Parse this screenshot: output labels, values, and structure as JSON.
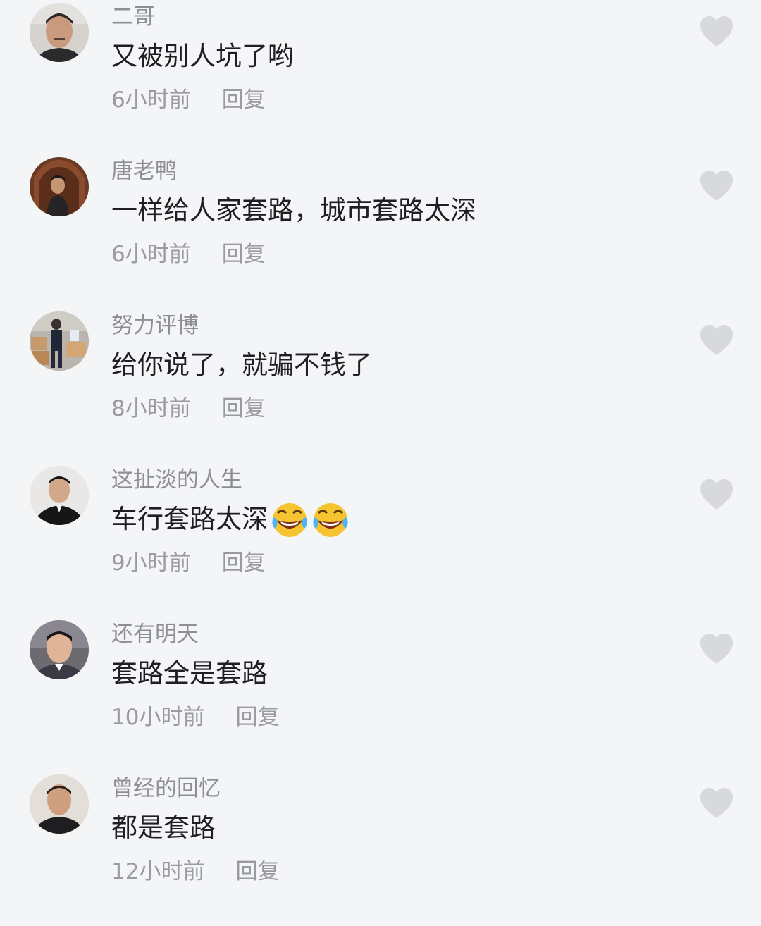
{
  "comments": [
    {
      "username": "二哥",
      "text": "又被别人坑了哟",
      "emoji_count": 0,
      "time": "6小时前",
      "reply_label": "回复",
      "avatar_icon": "avatar-man-1"
    },
    {
      "username": "唐老鸭",
      "text": "一样给人家套路，城市套路太深",
      "emoji_count": 0,
      "time": "6小时前",
      "reply_label": "回复",
      "avatar_icon": "avatar-man-carving"
    },
    {
      "username": "努力评博",
      "text": "给你说了，就骗不钱了",
      "emoji_count": 0,
      "time": "8小时前",
      "reply_label": "回复",
      "avatar_icon": "avatar-warehouse"
    },
    {
      "username": "这扯淡的人生",
      "text": "车行套路太深",
      "emoji_count": 2,
      "emoji_icon": "rofl-emoji",
      "time": "9小时前",
      "reply_label": "回复",
      "avatar_icon": "avatar-man-2"
    },
    {
      "username": "还有明天",
      "text": "套路全是套路",
      "emoji_count": 0,
      "time": "10小时前",
      "reply_label": "回复",
      "avatar_icon": "avatar-man-3"
    },
    {
      "username": "曾经的回忆",
      "text": "都是套路",
      "emoji_count": 0,
      "time": "12小时前",
      "reply_label": "回复",
      "avatar_icon": "avatar-man-4"
    }
  ],
  "colors": {
    "background": "#f4f5f7",
    "username": "#8e8f93",
    "text": "#1f1f21",
    "meta": "#9a9b9f",
    "like_icon": "#d8d9dc"
  }
}
